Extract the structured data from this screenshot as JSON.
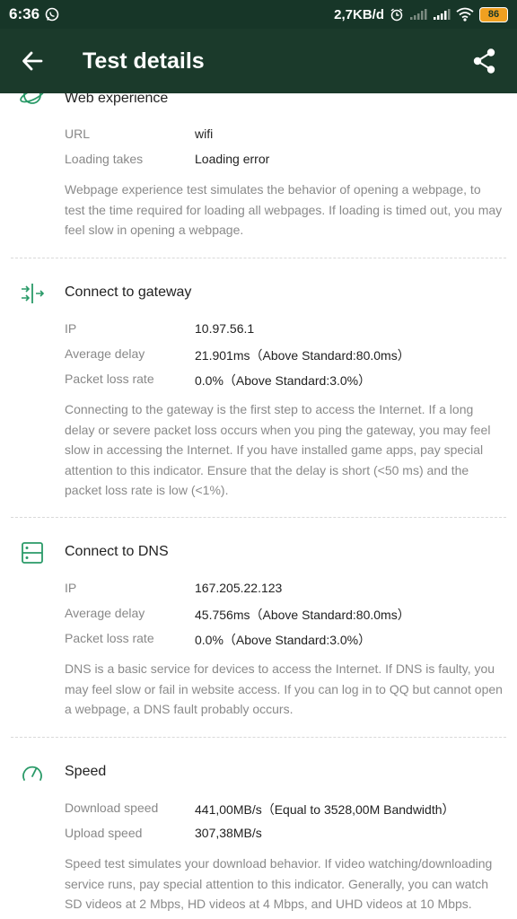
{
  "status_bar": {
    "time": "6:36",
    "network_speed": "2,7KB/d",
    "battery_level": "86",
    "icons": [
      "whatsapp-icon",
      "alarm-icon",
      "signal-icon",
      "signal-icon",
      "wifi-icon",
      "battery-icon"
    ]
  },
  "app_bar": {
    "title": "Test details",
    "back_icon": "arrow-left-icon",
    "share_icon": "share-icon"
  },
  "sections": {
    "web": {
      "title": "Web experience",
      "icon": "planet-icon",
      "rows": [
        {
          "label": "URL",
          "value": "wifi"
        },
        {
          "label": "Loading takes",
          "value": "Loading error"
        }
      ],
      "description": "Webpage experience test simulates the behavior of opening a webpage, to test the time required for loading all webpages. If loading is timed out, you may feel slow in opening a webpage."
    },
    "gateway": {
      "title": "Connect to gateway",
      "icon": "gateway-arrows-icon",
      "rows": [
        {
          "label": "IP",
          "value": "10.97.56.1"
        },
        {
          "label": "Average delay",
          "value": "21.901ms（Above Standard:80.0ms）"
        },
        {
          "label": "Packet loss rate",
          "value": "0.0%（Above Standard:3.0%）"
        }
      ],
      "description": "Connecting to the gateway is the first step to access the Internet. If a long delay or severe packet loss occurs when you ping the gateway, you may feel slow in accessing the Internet. If you have installed game apps, pay special attention to this indicator. Ensure that the delay is short (<50 ms) and the packet loss rate is low (<1%)."
    },
    "dns": {
      "title": "Connect to DNS",
      "icon": "server-icon",
      "rows": [
        {
          "label": "IP",
          "value": "167.205.22.123"
        },
        {
          "label": "Average delay",
          "value": "45.756ms（Above Standard:80.0ms）"
        },
        {
          "label": "Packet loss rate",
          "value": "0.0%（Above Standard:3.0%）"
        }
      ],
      "description": "DNS is a basic service for devices to access the Internet. If DNS is faulty, you may feel slow or fail in website access. If you can log in to QQ but cannot open a webpage, a DNS fault probably occurs."
    },
    "speed": {
      "title": "Speed",
      "icon": "speedometer-icon",
      "rows": [
        {
          "label": "Download speed",
          "value": "441,00MB/s（Equal to 3528,00M Bandwidth）"
        },
        {
          "label": "Upload speed",
          "value": "307,38MB/s"
        }
      ],
      "description": "Speed test simulates your download behavior. If video watching/downloading service runs, pay special attention to this indicator. Generally, you can watch SD videos at 2 Mbps, HD videos at 4 Mbps, and UHD videos at 10 Mbps."
    }
  },
  "colors": {
    "app_bar": "#1b3a2b",
    "status_bar": "#173628",
    "accent_icon": "#2a9a68",
    "primary_text": "#222222",
    "secondary_text": "#888888",
    "battery": "#f0a020"
  }
}
